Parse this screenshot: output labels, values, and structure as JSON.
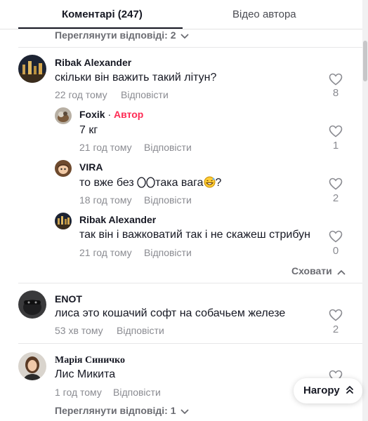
{
  "tabs": {
    "comments_label": "Коментарі (247)",
    "author_videos_label": "Відео автора"
  },
  "view_replies_top": "Переглянути відповіді: 2",
  "view_replies_bottom": "Переглянути відповіді: 1",
  "reply_label": "Відповісти",
  "hide_label": "Сховати",
  "go_top_label": "Нагору",
  "comments": [
    {
      "name": "Ribak Alexander",
      "text": "скільки він важить такий літун?",
      "time": "22 год тому",
      "likes": "8"
    },
    {
      "name": "ENOT",
      "text": "лиса это кошачий софт на собачьем железе",
      "time": "53 хв тому",
      "likes": "2"
    },
    {
      "name": "Марія Синичко",
      "text": "Лис Микита",
      "time": "1 год тому",
      "likes": ""
    }
  ],
  "replies": [
    {
      "name": "Foxik",
      "author_tag": "Автор",
      "separator": " · ",
      "text": "7 кг",
      "time": "21 год тому",
      "likes": "1"
    },
    {
      "name": "VIRA",
      "text_before": "то вже без ",
      "text_middle": "така вага",
      "text_after": "?",
      "time": "18 год тому",
      "likes": "2"
    },
    {
      "name": "Ribak Alexander",
      "text": "так він і важковатий так і не скажеш стрибун",
      "time": "21 год тому",
      "likes": "0"
    }
  ],
  "icons": {
    "like": "heart-outline-icon",
    "chevron_down": "chevron-down-icon",
    "chevron_up": "chevron-up-icon",
    "double_up": "double-chevron-up-icon",
    "egg": "egg-emoji",
    "grin": "grinning-sweat-emoji"
  },
  "colors": {
    "text": "#161823",
    "muted": "#8a8b91",
    "author_tag": "#fe2c55"
  }
}
